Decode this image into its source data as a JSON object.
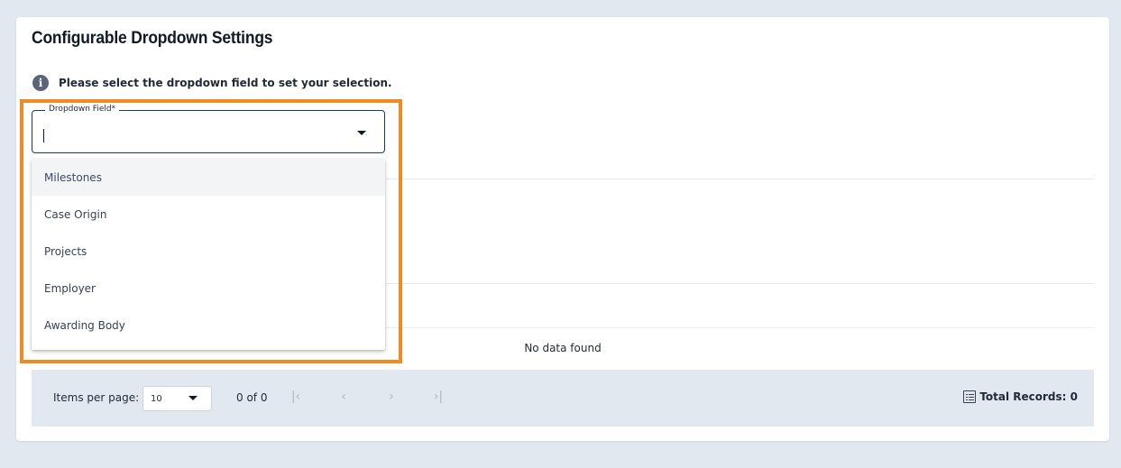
{
  "page": {
    "title": "Configurable Dropdown Settings",
    "info_text": "Please select the dropdown field to set your selection."
  },
  "dropdown": {
    "label": "Dropdown Field*",
    "value": "",
    "options": [
      "Milestones",
      "Case Origin",
      "Projects",
      "Employer",
      "Awarding Body"
    ],
    "highlighted_index": 0
  },
  "table": {
    "empty_message": "No data found"
  },
  "paginator": {
    "items_per_page_label": "Items per page:",
    "items_per_page_value": "10",
    "range_label": "0 of 0",
    "first_icon": "first-page-icon",
    "prev_icon": "chevron-left-icon",
    "next_icon": "chevron-right-icon",
    "last_icon": "last-page-icon",
    "total_records_label": "Total Records: 0"
  },
  "colors": {
    "highlight": "#f08a24",
    "field_border": "#1e3a5f",
    "background": "#e2e8f0"
  }
}
